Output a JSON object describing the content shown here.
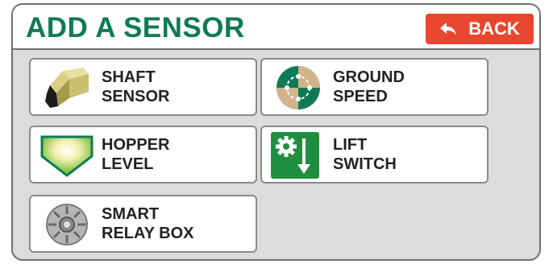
{
  "header": {
    "title": "ADD A SENSOR",
    "back_label": "BACK"
  },
  "colors": {
    "title": "#0f7a57",
    "back": "#e8462f",
    "panel": "#dcdcdc"
  },
  "sensors": [
    {
      "line1": "SHAFT",
      "line2": "SENSOR",
      "icon": "shaft-sensor-icon"
    },
    {
      "line1": "GROUND",
      "line2": "SPEED",
      "icon": "ground-speed-icon"
    },
    {
      "line1": "HOPPER",
      "line2": "LEVEL",
      "icon": "hopper-level-icon"
    },
    {
      "line1": "LIFT",
      "line2": "SWITCH",
      "icon": "lift-switch-icon"
    },
    {
      "line1": "SMART",
      "line2": "RELAY BOX",
      "icon": "smart-relay-box-icon"
    }
  ]
}
